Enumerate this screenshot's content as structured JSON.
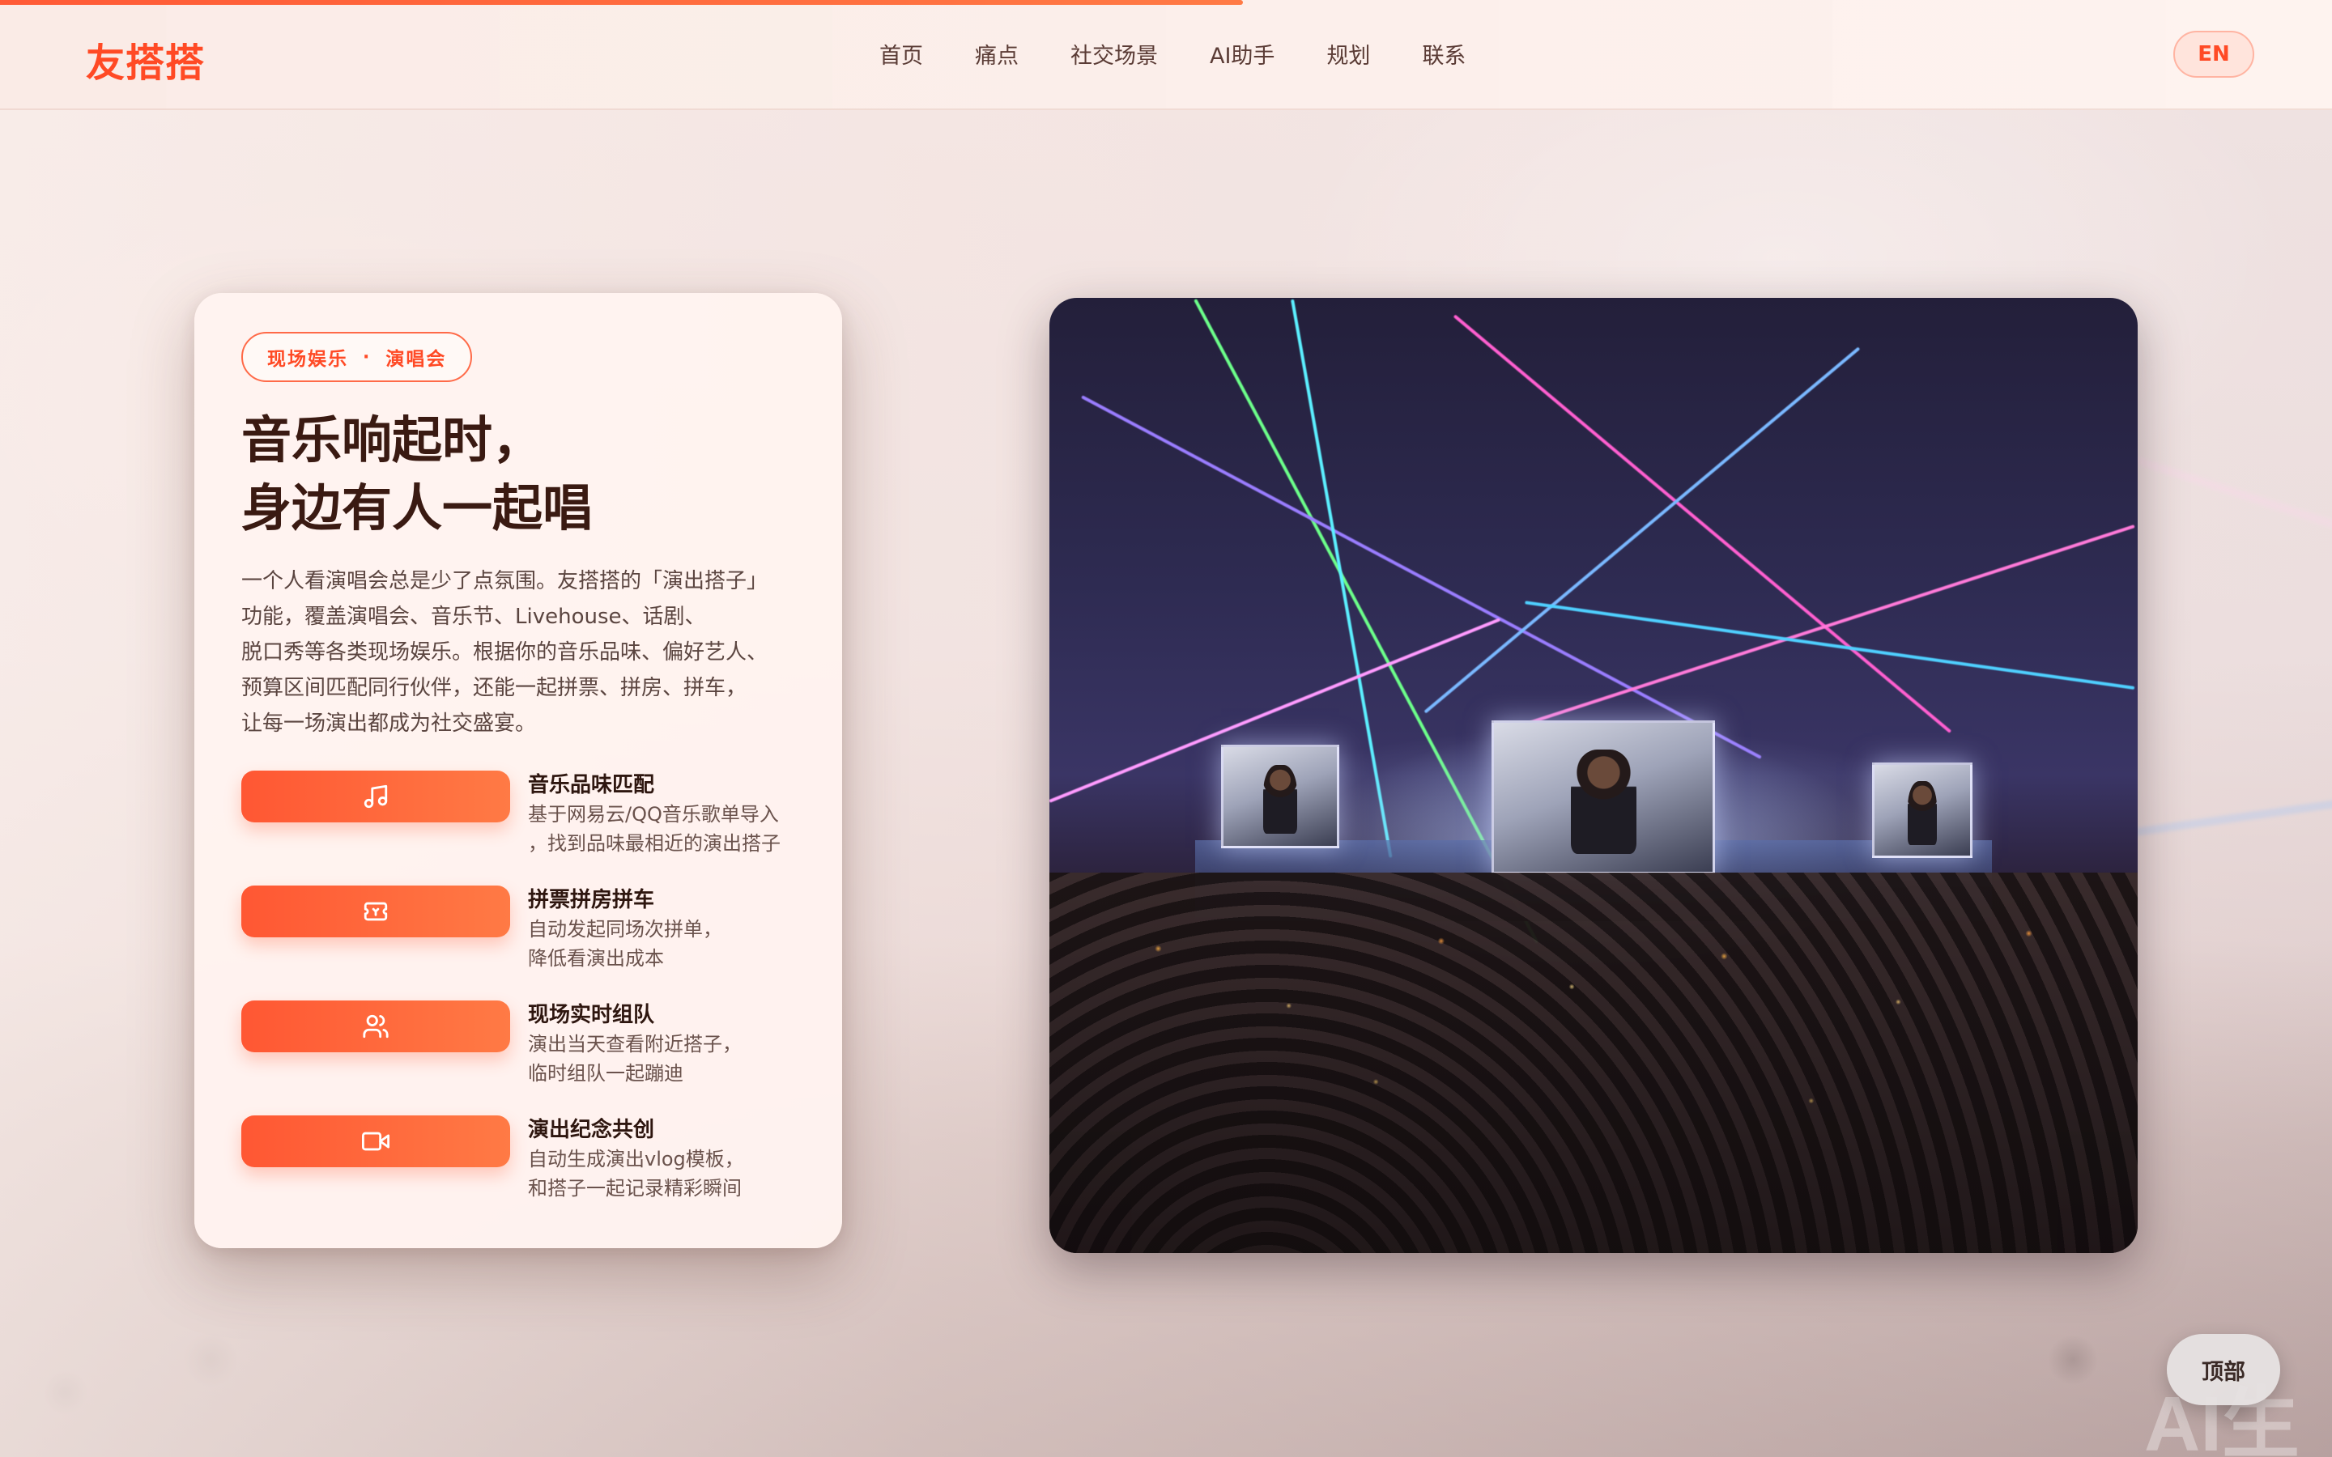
{
  "progress": {
    "fraction": 0.533
  },
  "header": {
    "logo": "友搭搭",
    "nav": [
      "首页",
      "痛点",
      "社交场景",
      "AI助手",
      "规划",
      "联系"
    ],
    "lang_button": "EN"
  },
  "card": {
    "tag_left": "现场娱乐",
    "tag_sep": "·",
    "tag_right": "演唱会",
    "headline_line1": "音乐响起时，",
    "headline_line2": "身边有人一起唱",
    "desc_lines": [
      "一个人看演唱会总是少了点氛围。友搭搭的「演出搭子」",
      "功能，覆盖演唱会、音乐节、Livehouse、话剧、",
      "脱口秀等各类现场娱乐。根据你的音乐品味、偏好艺人、",
      "预算区间匹配同行伙伴，还能一起拼票、拼房、拼车，",
      "让每一场演出都成为社交盛宴。"
    ],
    "features": [
      {
        "icon": "music-note-icon",
        "title": "音乐品味匹配",
        "desc1": "基于网易云/QQ音乐歌单导入",
        "desc2": "，找到品味最相近的演出搭子"
      },
      {
        "icon": "ticket-icon",
        "title": "拼票拼房拼车",
        "desc1": "自动发起同场次拼单，",
        "desc2": "降低看演出成本"
      },
      {
        "icon": "users-icon",
        "title": "现场实时组队",
        "desc1": "演出当天查看附近搭子，",
        "desc2": "临时组队一起蹦迪"
      },
      {
        "icon": "video-camera-icon",
        "title": "演出纪念共创",
        "desc1": "自动生成演出vlog模板，",
        "desc2": "和搭子一起记录精彩瞬间"
      }
    ]
  },
  "back_to_top": "顶部",
  "bg_watermark": "AI生",
  "colors": {
    "brand": "#ff4a25",
    "accent_gradient_start": "#ff5733",
    "accent_gradient_end": "#ff7a45",
    "heading": "#3a1a12"
  }
}
